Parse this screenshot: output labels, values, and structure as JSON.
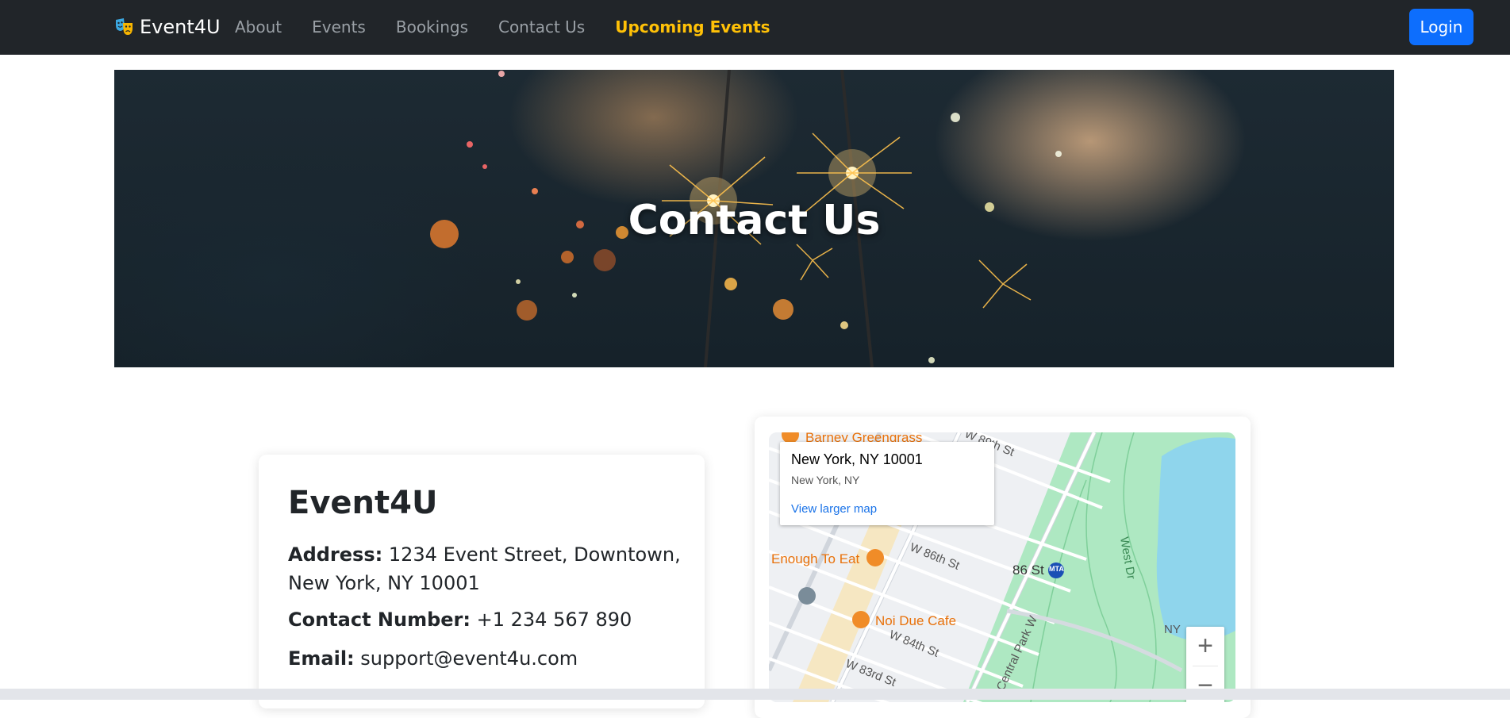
{
  "navbar": {
    "brand": "Event4U",
    "links": [
      "About",
      "Events",
      "Bookings",
      "Contact Us"
    ],
    "highlight_link": "Upcoming Events",
    "login_label": "Login",
    "colors": {
      "bg": "#212529",
      "highlight": "#ffc107",
      "login": "#0d6efd"
    }
  },
  "hero": {
    "title": "Contact Us"
  },
  "contact": {
    "name": "Event4U",
    "address_label": "Address:",
    "address": "1234 Event Street, Downtown, New York, NY 10001",
    "phone_label": "Contact Number:",
    "phone": "+1 234 567 890",
    "email_label": "Email:",
    "email": "support@event4u.com"
  },
  "map": {
    "popup_title": "New York, NY 10001",
    "popup_subtitle": "New York, NY",
    "popup_link": "View larger map",
    "labels": {
      "barney": "Barney Greengrass",
      "enough": "Enough To Eat",
      "noi": "Noi Due Cafe",
      "w86": "W 86th St",
      "w84": "W 84th St",
      "w83": "W 83rd St",
      "w89": "W 89th St",
      "st86": "86 St",
      "westdr": "West Dr",
      "cpw": "Central Park W",
      "ny": "NY",
      "subway": "MTA"
    },
    "zoom_in": "+",
    "zoom_out": "−"
  }
}
